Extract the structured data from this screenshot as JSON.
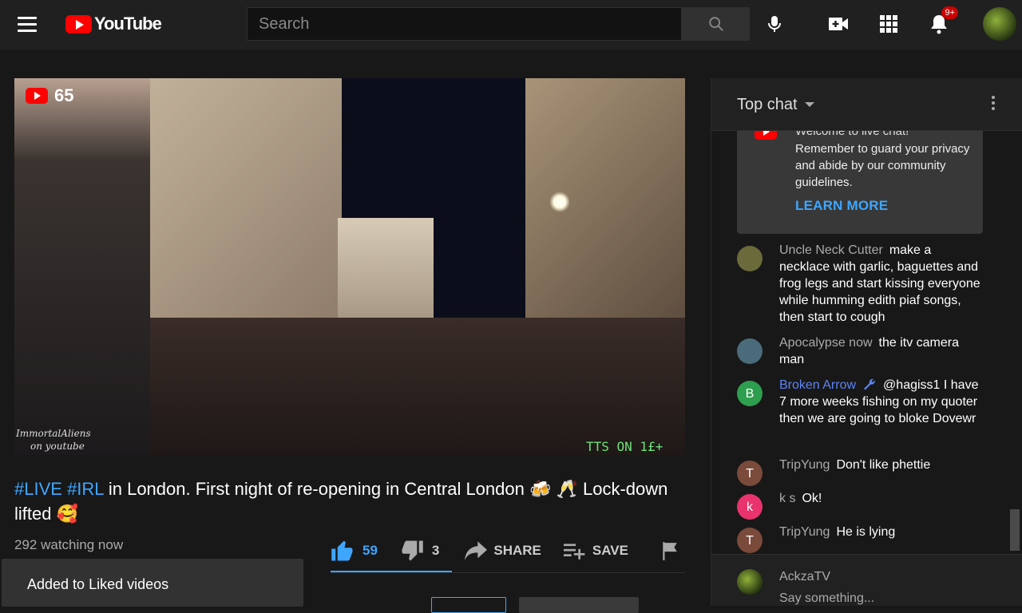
{
  "header": {
    "logo_text": "YouTube",
    "search_placeholder": "Search",
    "notification_count": "9+"
  },
  "video": {
    "viewer_count": "65",
    "watermark_line1": "ImmortalAliens",
    "watermark_line2": "on youtube",
    "overlay_text": "TTS ON 1£+",
    "title_hash1": "#LIVE",
    "title_hash2": "#IRL",
    "title_rest": "in London. First night of re-opening in Central London 🍻 🥂 Lock-down lifted 🥰",
    "watching": "292 watching now",
    "likes": "59",
    "dislikes": "3",
    "share_label": "SHARE",
    "save_label": "SAVE"
  },
  "toast": {
    "text": "Added to Liked videos"
  },
  "chat": {
    "header_label": "Top chat",
    "welcome_clipped": "Welcome to live chat!",
    "welcome_message": "Remember to guard your privacy and abide by our community guidelines.",
    "learn_more": "LEARN MORE",
    "messages": [
      {
        "author": "Uncle Neck Cutter",
        "text": "make a necklace with garlic, baguettes and frog legs and start kissing everyone while humming edith piaf songs, then start to cough",
        "avatar_letter": "",
        "avatar_color": "#6b6a3a"
      },
      {
        "author": "Apocalypse now",
        "text": "the itv camera man",
        "avatar_letter": "",
        "avatar_color": "#4a6b7a"
      },
      {
        "author": "Broken Arrow",
        "text": "@hagiss1 I have 7 more weeks fishing on my quoter then we are going to bloke Dovewr",
        "avatar_letter": "B",
        "avatar_color": "#2e9e4f"
      },
      {
        "author": "TripYung",
        "text": "Don't like phettie",
        "avatar_letter": "T",
        "avatar_color": "#7a4a3a"
      },
      {
        "author": "k s",
        "text": "Ok!",
        "avatar_letter": "k",
        "avatar_color": "#e8336c"
      },
      {
        "author": "TripYung",
        "text": "He is lying",
        "avatar_letter": "T",
        "avatar_color": "#7a4a3a"
      }
    ],
    "user_name": "AckzaTV",
    "input_placeholder": "Say something..."
  }
}
